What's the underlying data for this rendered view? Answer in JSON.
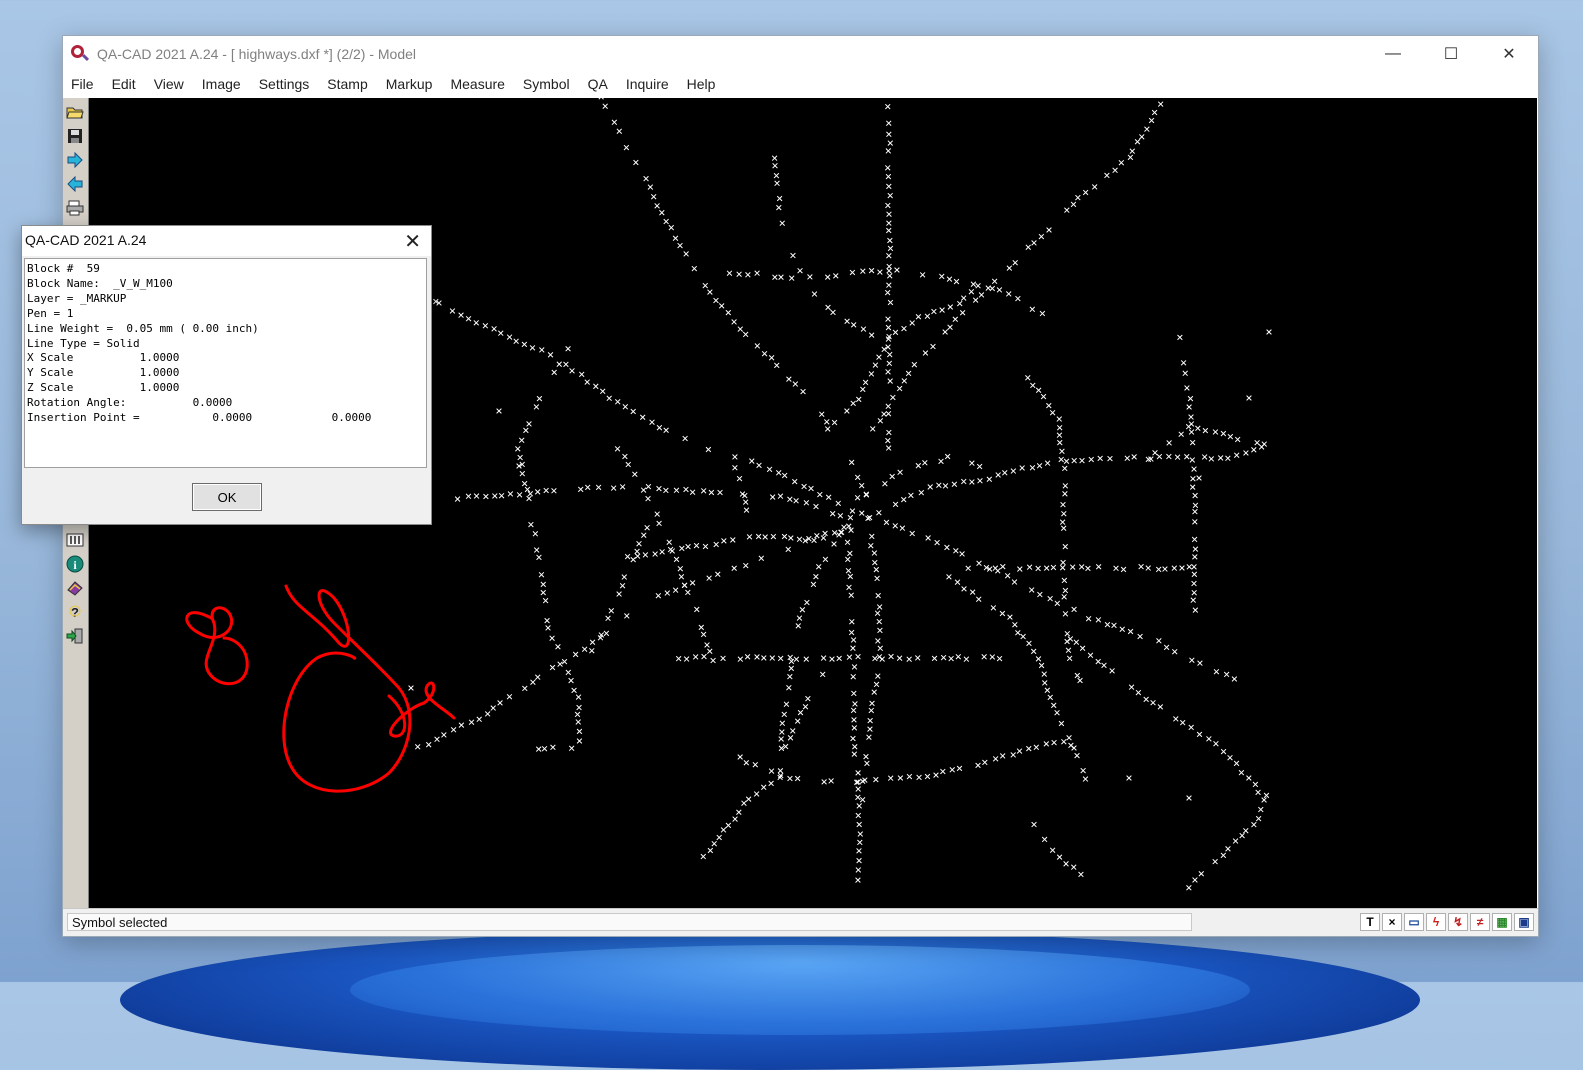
{
  "window": {
    "title": "QA-CAD 2021 A.24  -  [ highways.dxf *] (2/2)  -  Model",
    "controls": {
      "minimize": "—",
      "maximize": "☐",
      "close": "✕"
    }
  },
  "menu": [
    "File",
    "Edit",
    "View",
    "Image",
    "Settings",
    "Stamp",
    "Markup",
    "Measure",
    "Symbol",
    "QA",
    "Inquire",
    "Help"
  ],
  "toolbar_top": [
    "open-folder-icon",
    "save-icon",
    "forward-arrow-icon",
    "back-arrow-icon",
    "print-icon"
  ],
  "toolbar_bottom": [
    {
      "icon": "layers-icon",
      "glyph": "⫶"
    },
    {
      "icon": "info-icon",
      "glyph": "i"
    },
    {
      "icon": "book-icon",
      "glyph": "▰"
    },
    {
      "icon": "help-icon",
      "glyph": "?"
    },
    {
      "icon": "exit-icon",
      "glyph": "⇥"
    }
  ],
  "dialog": {
    "title": "QA-CAD 2021 A.24",
    "close": "✕",
    "lines": [
      "Block #  59",
      "Block Name:  _V_W_M100",
      "Layer = _MARKUP",
      "Pen = 1",
      "Line Weight =  0.05 mm ( 0.00 inch)",
      "Line Type = Solid",
      "X Scale          1.0000",
      "Y Scale          1.0000",
      "Z Scale          1.0000",
      "Rotation Angle:          0.0000",
      "Insertion Point =           0.0000            0.0000"
    ],
    "ok_label": "OK"
  },
  "status": {
    "text": "Symbol selected",
    "icons": [
      {
        "icon": "text-icon",
        "glyph": "T"
      },
      {
        "icon": "cross-icon",
        "glyph": "×"
      },
      {
        "icon": "window-icon",
        "glyph": "▭"
      },
      {
        "icon": "lightning-icon",
        "glyph": "ϟ"
      },
      {
        "icon": "snap-icon",
        "glyph": "↯"
      },
      {
        "icon": "multi-snap-icon",
        "glyph": "≠"
      },
      {
        "icon": "color-icon",
        "glyph": "▦"
      },
      {
        "icon": "screen-icon",
        "glyph": "▣"
      }
    ]
  },
  "colors": {
    "canvas": "#000000",
    "markers": "#ffffff",
    "markup": "#ff0000",
    "accent": "#b0213a"
  }
}
